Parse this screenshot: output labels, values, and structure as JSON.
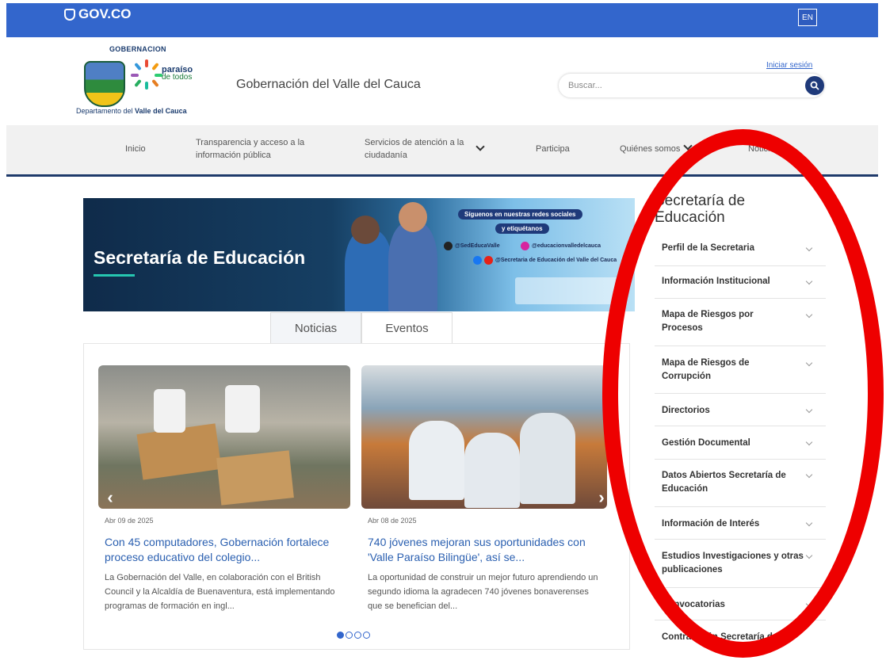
{
  "gov_bar": {
    "logo_text": "GOV.CO",
    "lang_button": "EN"
  },
  "header": {
    "logo": {
      "top_text": "GOBERNACION",
      "paraiso": "paraíso",
      "de_todos": "de todos",
      "depto_prefix": "Departamento del ",
      "depto_bold": "Valle del Cauca"
    },
    "site_title": "Gobernación del Valle del Cauca",
    "login": "Iniciar sesión",
    "search_placeholder": "Buscar..."
  },
  "nav": {
    "items": [
      {
        "label": "Inicio"
      },
      {
        "label": "Transparencia y acceso a la información pública"
      },
      {
        "label": "Servicios de atención a la ciudadanía"
      },
      {
        "label": "Participa"
      },
      {
        "label": "Quiénes somos"
      },
      {
        "label": "Noticias"
      }
    ]
  },
  "banner": {
    "title": "Secretaría de Educación",
    "follow": "Síguenos en nuestras redes sociales",
    "tag": "y etiquétanos",
    "x_handle": "@SedEducaValle",
    "ig_handle": "@educacionvalledelcauca",
    "fb_handle": "@Secretaria de Educación del Valle del Cauca"
  },
  "tabs": [
    {
      "label": "Noticias",
      "active": true
    },
    {
      "label": "Eventos",
      "active": false
    }
  ],
  "news": [
    {
      "date": "Abr 09 de 2025",
      "title": "Con 45 computadores, Gobernación fortalece proceso educativo del colegio...",
      "excerpt": "La Gobernación del Valle, en colaboración con el British Council y la Alcaldía de Buenaventura, está implementando programas de formación en ingl..."
    },
    {
      "date": "Abr 08 de 2025",
      "title": "740 jóvenes mejoran sus oportunidades con 'Valle Paraíso Bilingüe', así se...",
      "excerpt": "La oportunidad de construir un mejor futuro aprendiendo un segundo idioma la agradecen 740 jóvenes bonaverenses que se benefician del..."
    }
  ],
  "carousel": {
    "arrow_left": "‹",
    "arrow_right": "›"
  },
  "sidebar": {
    "title": "Secretaría de Educación",
    "items": [
      {
        "label": "Perfil de la Secretaria"
      },
      {
        "label": "Información Institucional"
      },
      {
        "label": "Mapa de Riesgos por Procesos"
      },
      {
        "label": "Mapa de Riesgos de Corrupción"
      },
      {
        "label": "Directorios"
      },
      {
        "label": "Gestión Documental"
      },
      {
        "label": "Datos Abiertos Secretaría de Educación"
      },
      {
        "label": "Información de Interés"
      },
      {
        "label": "Estudios Investigaciones y otras publicaciones"
      },
      {
        "label": "Convocatorias"
      },
      {
        "label": "Contratación Secretaría de"
      }
    ]
  },
  "colors": {
    "gov_blue": "#3366cc",
    "nav_border": "#1f3a6b",
    "link_blue": "#2a5fb0",
    "annotation_red": "#ee0000"
  },
  "icons": [
    "gov-shield-icon",
    "search-icon",
    "chevron-down-icon",
    "x-icon",
    "instagram-icon",
    "facebook-icon",
    "youtube-icon",
    "arrow-left-icon",
    "arrow-right-icon"
  ]
}
